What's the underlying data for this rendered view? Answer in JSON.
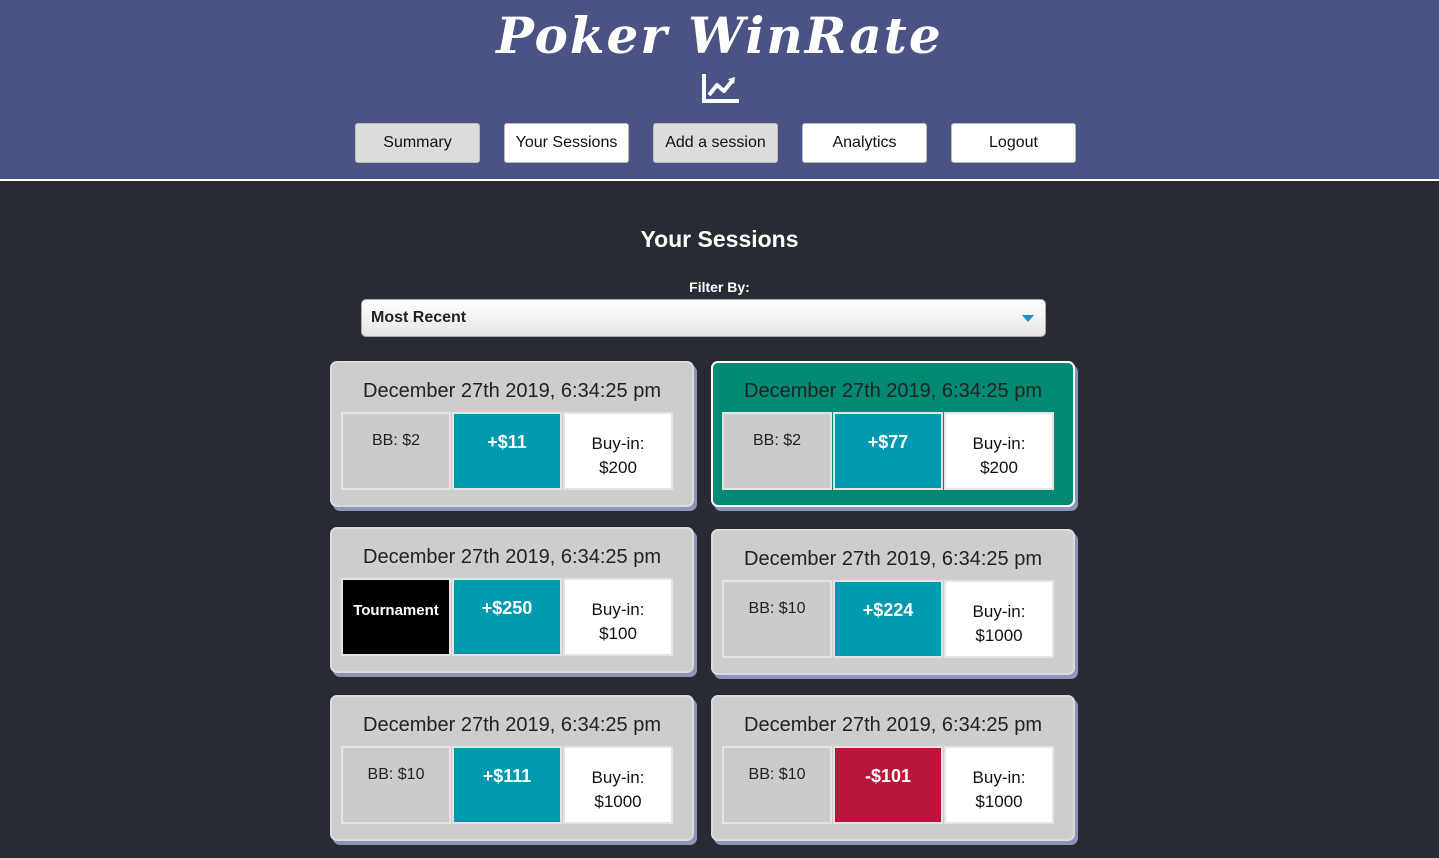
{
  "header": {
    "title": "Poker WinRate",
    "icon": "chart-line-icon",
    "accent_color": "#4b5284"
  },
  "nav": {
    "items": [
      {
        "label": "Summary"
      },
      {
        "label": "Your Sessions"
      },
      {
        "label": "Add a session"
      },
      {
        "label": "Analytics"
      },
      {
        "label": "Logout"
      }
    ]
  },
  "main": {
    "title": "Your Sessions",
    "filter_label": "Filter By:",
    "filter_value": "Most Recent"
  },
  "sessions": [
    {
      "date": "December 27th 2019, 6:34:25 pm",
      "type": "BB: $2",
      "profit": "+$11",
      "buyin_label": "Buy-in:",
      "buyin": "$200"
    },
    {
      "date": "December 27th 2019, 6:34:25 pm",
      "type": "BB: $2",
      "profit": "+$77",
      "buyin_label": "Buy-in:",
      "buyin": "$200"
    },
    {
      "date": "December 27th 2019, 6:34:25 pm",
      "type": "Tournament",
      "profit": "+$250",
      "buyin_label": "Buy-in:",
      "buyin": "$100"
    },
    {
      "date": "December 27th 2019, 6:34:25 pm",
      "type": "BB: $10",
      "profit": "+$224",
      "buyin_label": "Buy-in:",
      "buyin": "$1000"
    },
    {
      "date": "December 27th 2019, 6:34:25 pm",
      "type": "BB: $10",
      "profit": "+$111",
      "buyin_label": "Buy-in:",
      "buyin": "$1000"
    },
    {
      "date": "December 27th 2019, 6:34:25 pm",
      "type": "BB: $10",
      "profit": "-$101",
      "buyin_label": "Buy-in:",
      "buyin": "$1000"
    }
  ],
  "colors": {
    "positive": "#0099b0",
    "negative": "#b8163b",
    "highlight": "#008a74",
    "background": "#272b33"
  }
}
